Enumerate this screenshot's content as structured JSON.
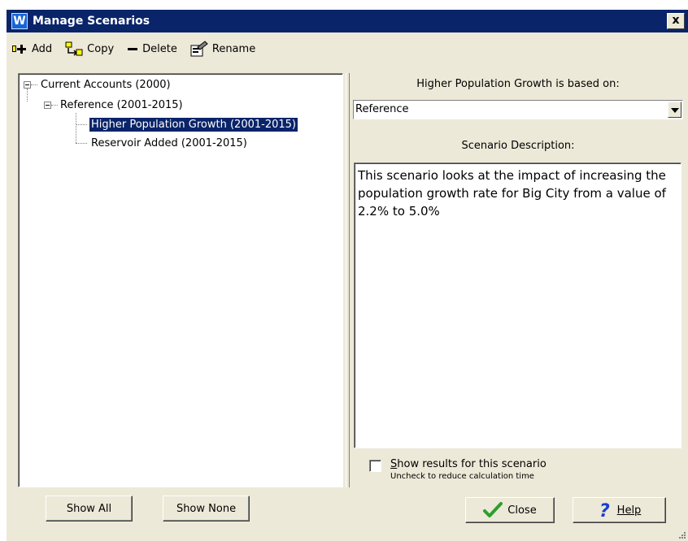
{
  "window": {
    "title": "Manage Scenarios",
    "logo_letter": "W",
    "close_glyph": "x"
  },
  "toolbar": {
    "add_label": "Add",
    "copy_label": "Copy",
    "delete_label": "Delete",
    "rename_label": "Rename"
  },
  "tree": {
    "root": "Current Accounts (2000)",
    "reference": "Reference (2001-2015)",
    "children": [
      "Higher Population Growth (2001-2015)",
      "Reservoir Added (2001-2015)"
    ],
    "selected_index": 0
  },
  "right": {
    "based_on_header": "Higher Population Growth is based on:",
    "based_on_value": "Reference",
    "description_header": "Scenario Description:",
    "description_text": "This scenario looks at the impact of increasing the population growth rate for Big City from a value of 2.2% to 5.0%",
    "show_results_label": "Show results for this scenario",
    "show_results_mnemonic": "S",
    "show_results_hint": "Uncheck to reduce calculation time",
    "show_results_checked": false
  },
  "buttons": {
    "show_all": "Show All",
    "show_none": "Show None",
    "close": "Close",
    "help": "Help"
  },
  "colors": {
    "titlebar": "#0a246a",
    "face": "#ece9d8",
    "selection": "#0a246a",
    "check_green": "#2e9e2e",
    "help_blue": "#1a3fd1"
  }
}
